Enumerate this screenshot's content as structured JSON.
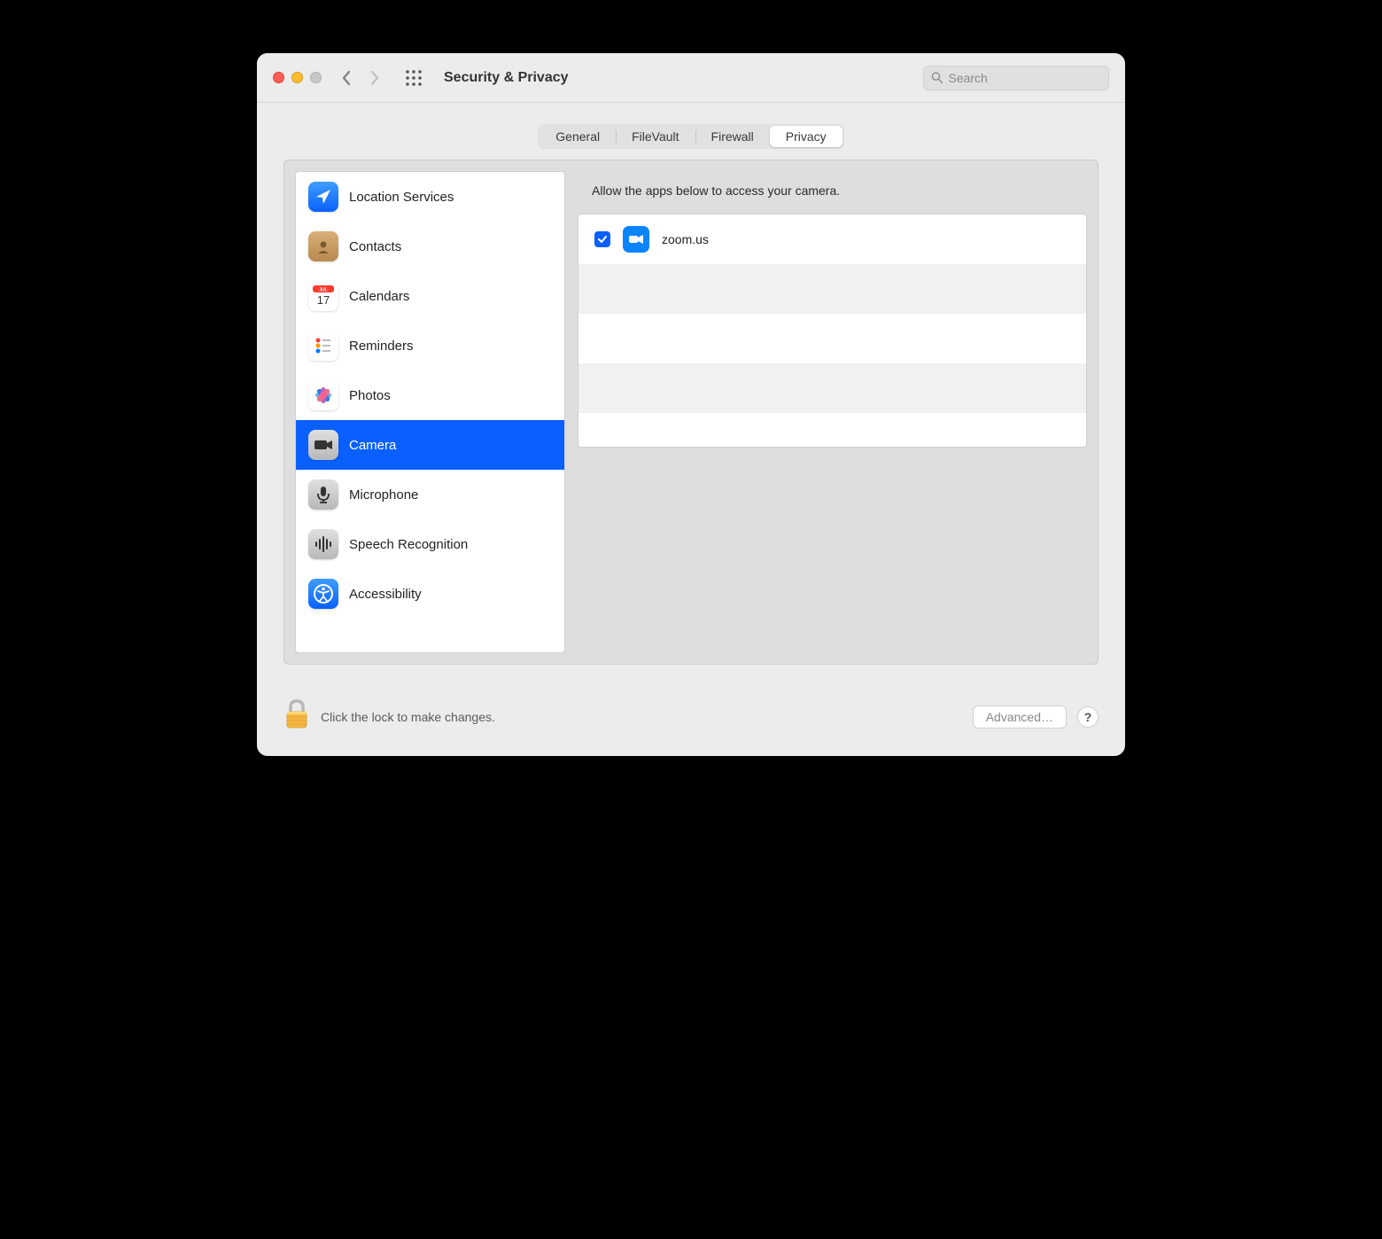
{
  "window": {
    "title": "Security & Privacy"
  },
  "search": {
    "placeholder": "Search"
  },
  "tabs": [
    {
      "label": "General",
      "active": false
    },
    {
      "label": "FileVault",
      "active": false
    },
    {
      "label": "Firewall",
      "active": false
    },
    {
      "label": "Privacy",
      "active": true
    }
  ],
  "sidebar": {
    "items": [
      {
        "label": "Location Services",
        "icon": "location",
        "selected": false
      },
      {
        "label": "Contacts",
        "icon": "contacts",
        "selected": false
      },
      {
        "label": "Calendars",
        "icon": "calendar",
        "selected": false
      },
      {
        "label": "Reminders",
        "icon": "reminders",
        "selected": false
      },
      {
        "label": "Photos",
        "icon": "photos",
        "selected": false
      },
      {
        "label": "Camera",
        "icon": "camera",
        "selected": true
      },
      {
        "label": "Microphone",
        "icon": "microphone",
        "selected": false
      },
      {
        "label": "Speech Recognition",
        "icon": "speech",
        "selected": false
      },
      {
        "label": "Accessibility",
        "icon": "accessibility",
        "selected": false
      }
    ]
  },
  "detail": {
    "header": "Allow the apps below to access your camera.",
    "apps": [
      {
        "name": "zoom.us",
        "checked": true,
        "icon": "zoom"
      }
    ]
  },
  "footer": {
    "lock_text": "Click the lock to make changes.",
    "advanced_label": "Advanced…",
    "help_label": "?"
  }
}
